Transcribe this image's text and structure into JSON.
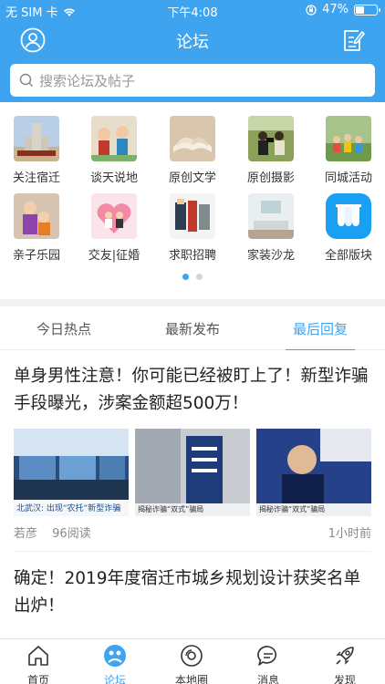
{
  "status_bar": {
    "carrier": "无 SIM 卡",
    "time": "下午4:08",
    "battery": "47%",
    "battery_level": 0.47
  },
  "nav": {
    "title": "论坛"
  },
  "search": {
    "placeholder": "搜索论坛及帖子"
  },
  "boards": [
    {
      "label": "关注宿迁",
      "icon": "tower-photo"
    },
    {
      "label": "谈天说地",
      "icon": "figurines-photo"
    },
    {
      "label": "原创文学",
      "icon": "open-book-photo"
    },
    {
      "label": "原创摄影",
      "icon": "photographers-photo"
    },
    {
      "label": "同城活动",
      "icon": "group-picnic-photo"
    },
    {
      "label": "亲子乐园",
      "icon": "family-photo"
    },
    {
      "label": "交友|征婚",
      "icon": "couple-heart-photo"
    },
    {
      "label": "求职招聘",
      "icon": "job-photo"
    },
    {
      "label": "家装沙龙",
      "icon": "living-room-photo"
    },
    {
      "label": "全部版块",
      "icon": "all-boards-icon"
    }
  ],
  "pager": {
    "pages": 2,
    "current": 1
  },
  "tabs": [
    {
      "label": "今日热点",
      "active": false
    },
    {
      "label": "最新发布",
      "active": false
    },
    {
      "label": "最后回复",
      "active": true
    }
  ],
  "posts": [
    {
      "title": "单身男性注意！你可能已经被盯上了！新型诈骗手段曝光，涉案金额超500万！",
      "images": [
        {
          "caption": "北武汉: 出现“农托”新型诈骗"
        },
        {
          "caption": "揭秘诈骗“双式”骗局"
        },
        {
          "caption": "揭秘诈骗“双式”骗局"
        }
      ],
      "author": "若彦",
      "reads": "96阅读",
      "time": "1小时前"
    },
    {
      "title": "确定！2019年度宿迁市城乡规划设计获奖名单出炉！"
    }
  ],
  "tabbar": [
    {
      "label": "首页",
      "icon": "home-icon",
      "active": false
    },
    {
      "label": "论坛",
      "icon": "forum-icon",
      "active": true
    },
    {
      "label": "本地圈",
      "icon": "local-circle-icon",
      "active": false
    },
    {
      "label": "消息",
      "icon": "message-icon",
      "active": false
    },
    {
      "label": "发现",
      "icon": "discover-rocket-icon",
      "active": false
    }
  ],
  "colors": {
    "brand": "#3fa4f0",
    "text": "#222222",
    "muted": "#888888"
  }
}
